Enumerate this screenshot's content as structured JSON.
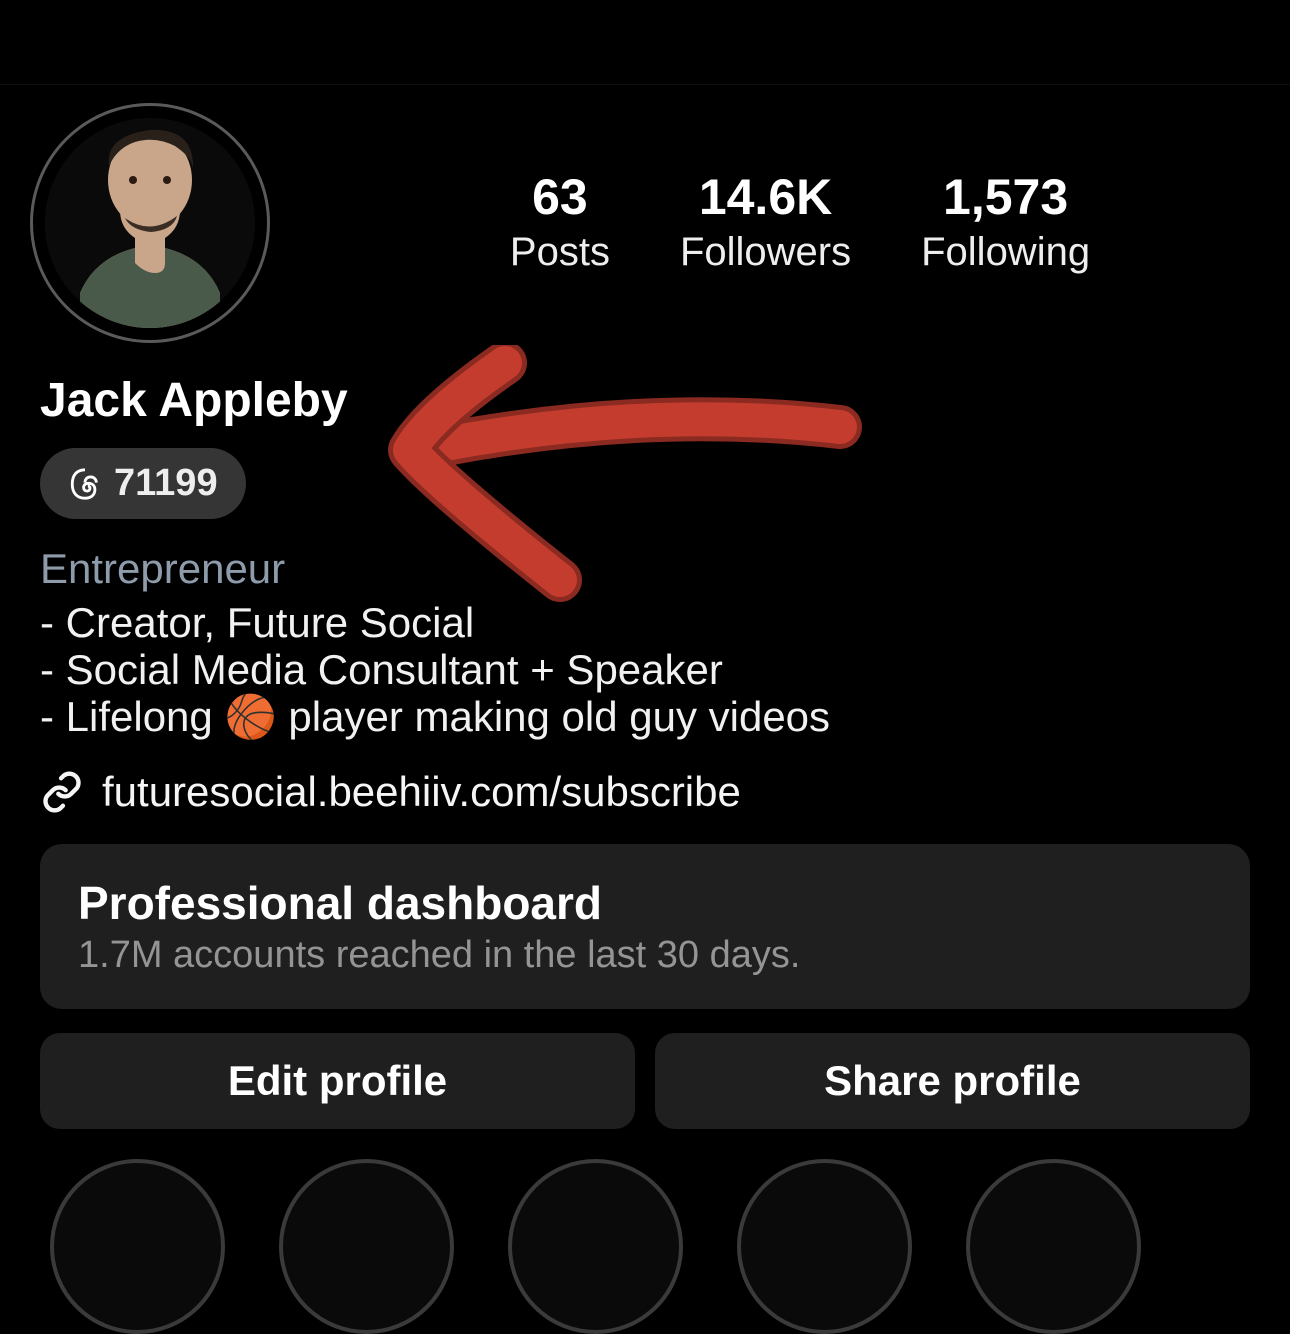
{
  "profile": {
    "display_name": "Jack Appleby",
    "threads_count": "71199",
    "category": "Entrepreneur",
    "bio_lines": [
      "- Creator, Future Social",
      "- Social Media Consultant + Speaker",
      "- Lifelong 🏀 player making old guy videos"
    ],
    "link": "futuresocial.beehiiv.com/subscribe"
  },
  "stats": {
    "posts": {
      "value": "63",
      "label": "Posts"
    },
    "followers": {
      "value": "14.6K",
      "label": "Followers"
    },
    "following": {
      "value": "1,573",
      "label": "Following"
    }
  },
  "dashboard": {
    "title": "Professional dashboard",
    "subtitle": "1.7M accounts reached in the last 30 days."
  },
  "actions": {
    "edit": "Edit profile",
    "share": "Share profile"
  },
  "annotation": {
    "arrow_color": "#c03c2e"
  }
}
